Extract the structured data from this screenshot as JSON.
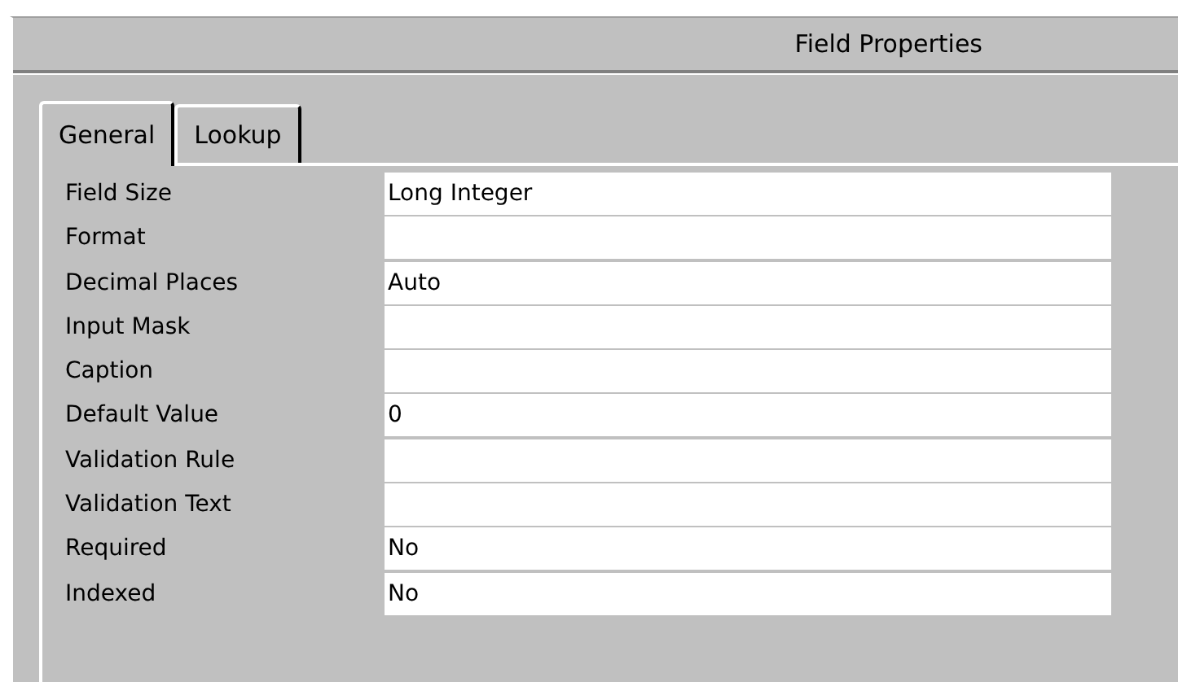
{
  "header": {
    "title": "Field Properties"
  },
  "tabs": [
    {
      "label": "General",
      "selected": true
    },
    {
      "label": "Lookup",
      "selected": false
    }
  ],
  "properties": [
    {
      "label": "Field Size",
      "value": "Long Integer"
    },
    {
      "label": "Format"
    },
    {
      "label": "Decimal Places",
      "value": "Auto"
    },
    {
      "label": "Input Mask"
    },
    {
      "label": "Caption"
    },
    {
      "label": "Default Value",
      "value": "0"
    },
    {
      "label": "Validation Rule"
    },
    {
      "label": "Validation Text"
    },
    {
      "label": "Required",
      "value": "No"
    },
    {
      "label": "Indexed",
      "value": "No"
    }
  ]
}
